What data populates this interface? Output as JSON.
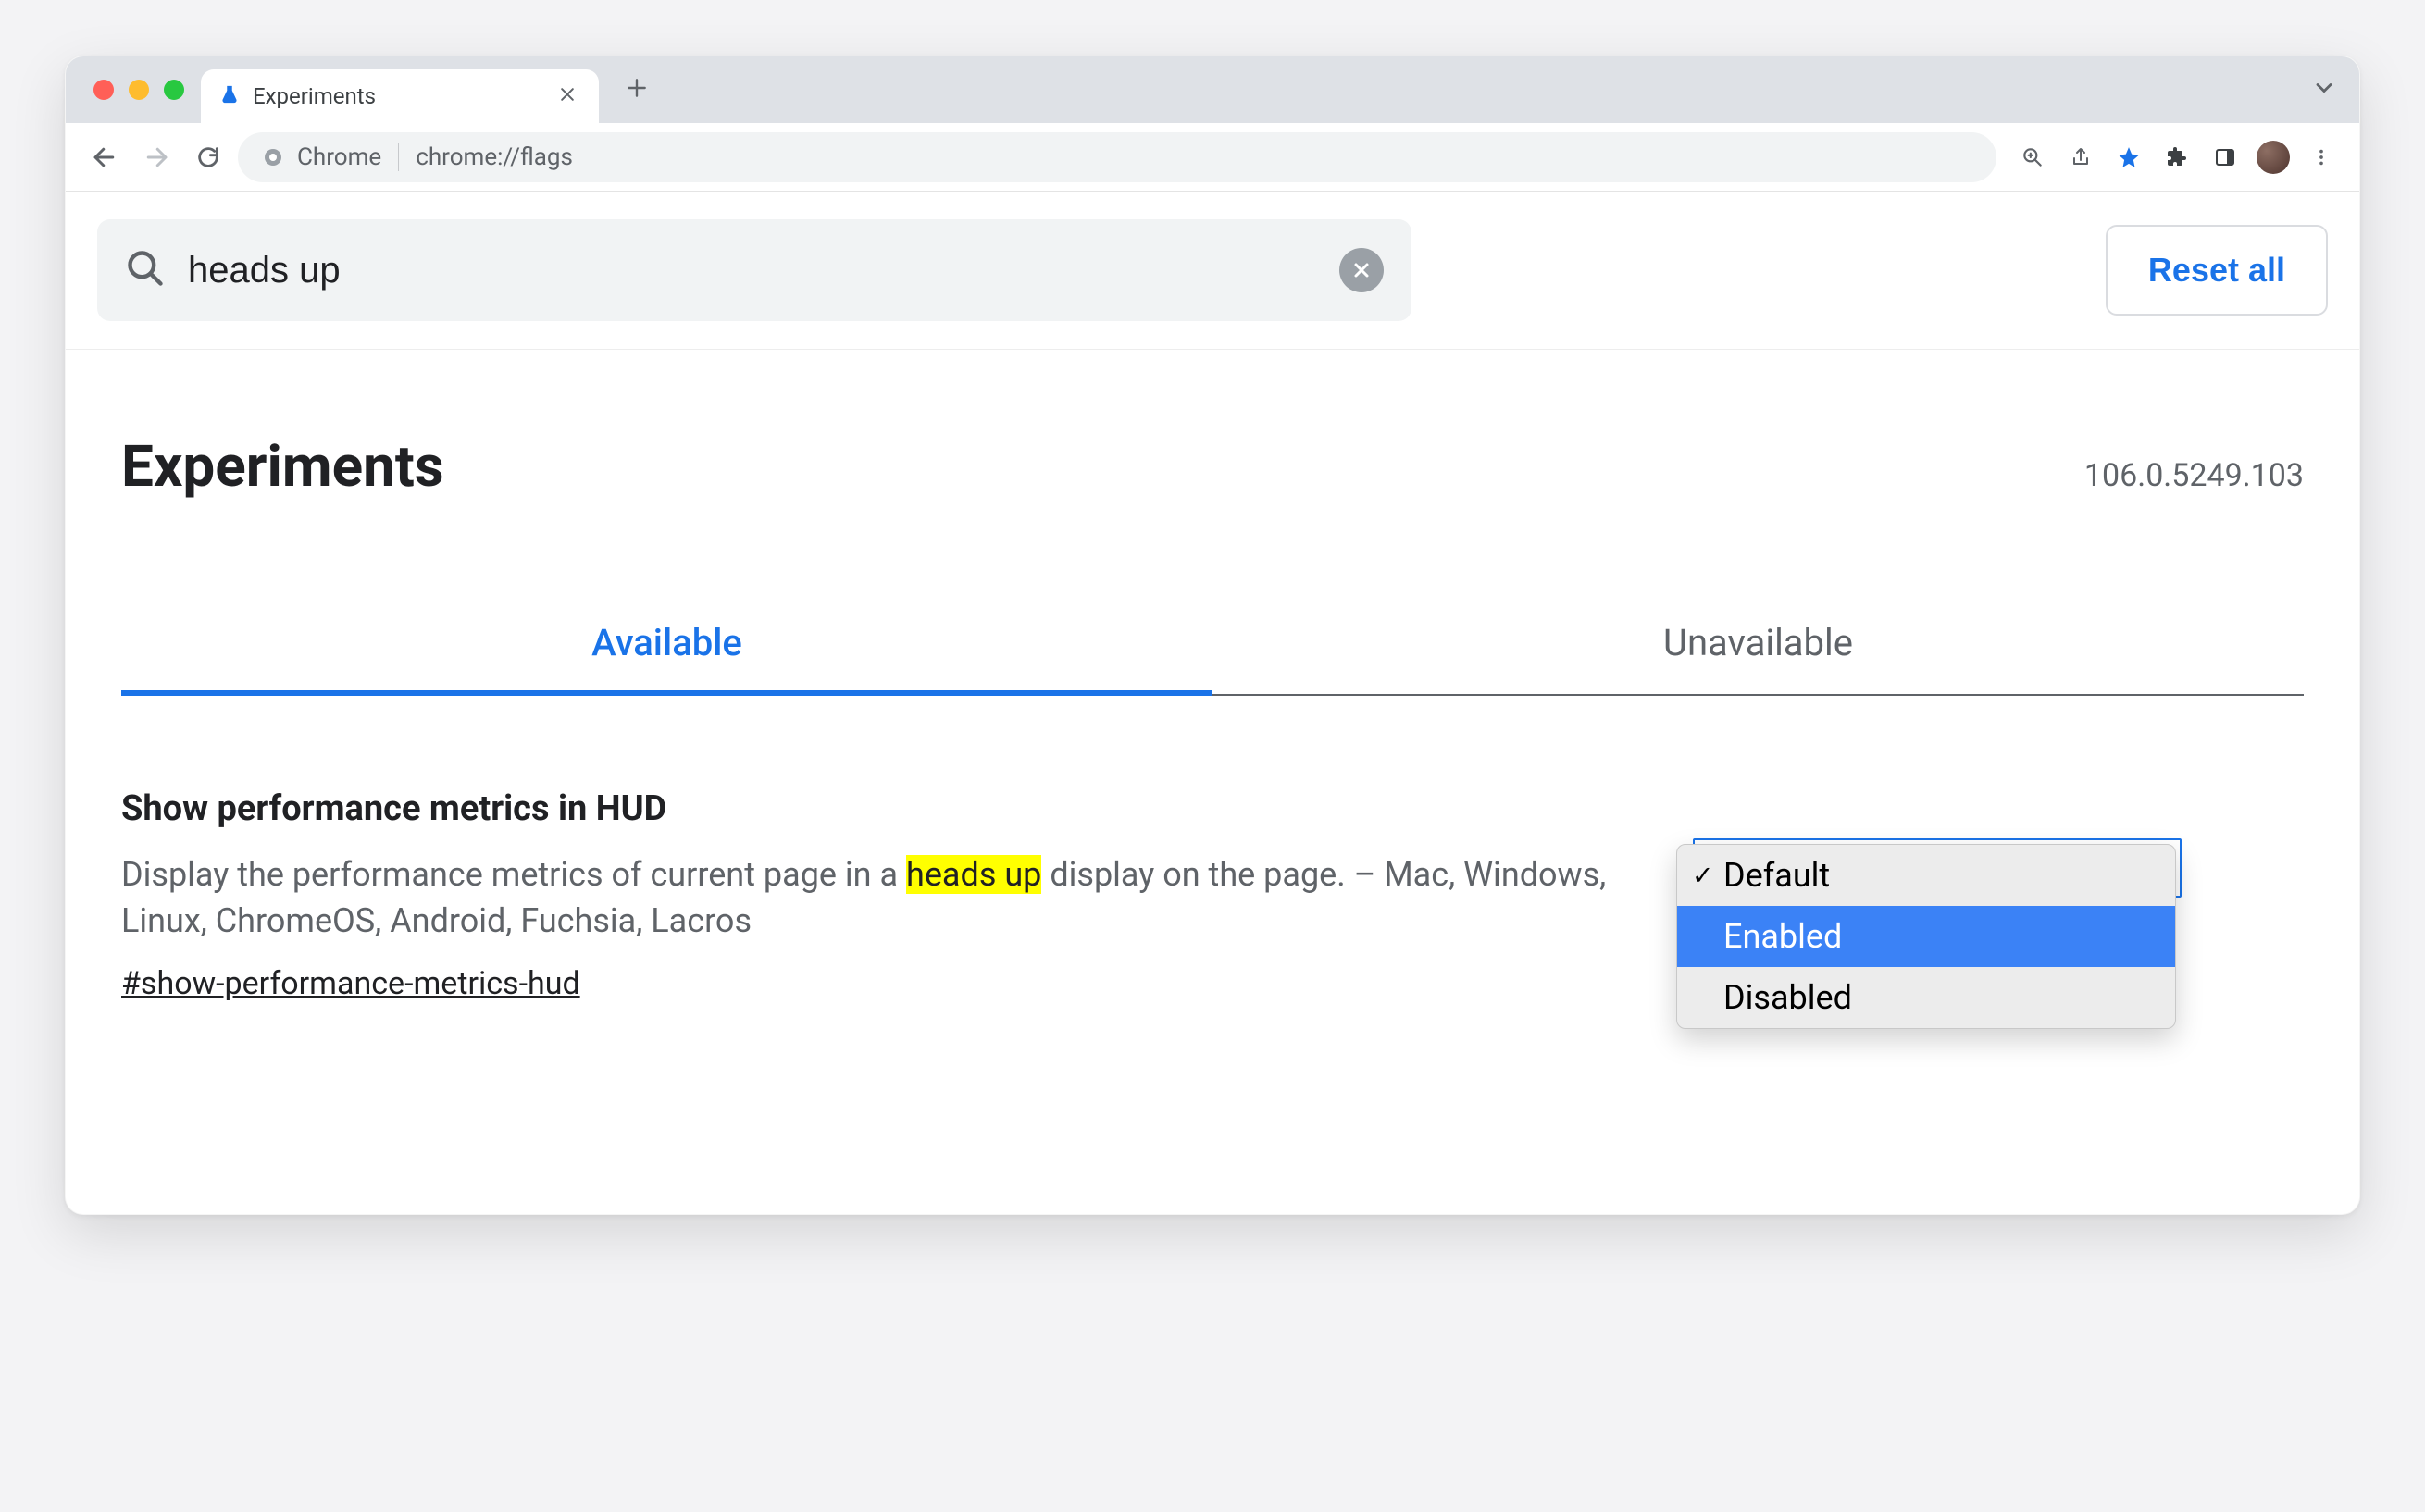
{
  "chrome": {
    "tab_title": "Experiments",
    "url_chip_label": "Chrome",
    "url": "chrome://flags"
  },
  "search": {
    "value": "heads up",
    "reset_all": "Reset all"
  },
  "header": {
    "title": "Experiments",
    "version": "106.0.5249.103"
  },
  "tabs": {
    "available": "Available",
    "unavailable": "Unavailable"
  },
  "flag": {
    "title": "Show performance metrics in HUD",
    "desc_before": "Display the performance metrics of current page in a ",
    "highlight": "heads up",
    "desc_after": " display on the page. – Mac, Windows, Linux, ChromeOS, Android, Fuchsia, Lacros",
    "id": "#show-performance-metrics-hud",
    "options": {
      "default": "Default",
      "enabled": "Enabled",
      "disabled": "Disabled"
    }
  }
}
